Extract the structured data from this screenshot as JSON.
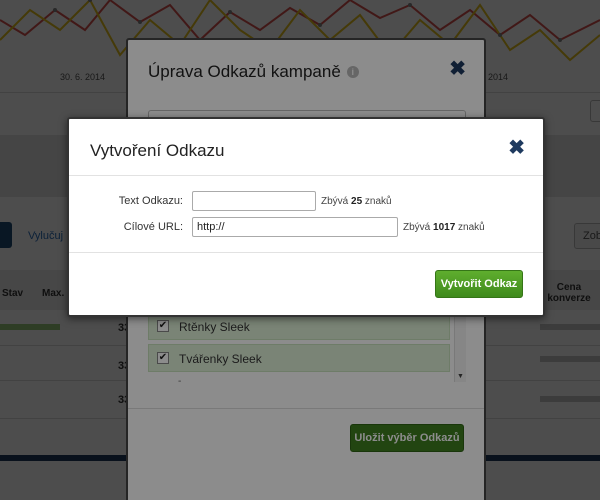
{
  "background": {
    "chart_axis_labels": [
      "30. 6. 2014",
      "2014"
    ],
    "link_text": "Vylučuj",
    "right_button_label": "Zob",
    "table_headers": [
      "Stav",
      "Max.",
      "Cena konverze"
    ],
    "row_values": [
      "33",
      "33",
      "33"
    ]
  },
  "modal_edit": {
    "title": "Úprava Odkazů kampaně",
    "info_icon": "i",
    "close_icon": "✖",
    "list_items": [
      {
        "label": "Rtěnky Sleek",
        "checked": true
      },
      {
        "label": "Tvářenky Sleek",
        "checked": true
      }
    ],
    "list_more": "-",
    "save_label": "Uložit výběr Odkazů"
  },
  "modal_create": {
    "title": "Vytvoření Odkazu",
    "close_icon": "✖",
    "text_label": "Text Odkazu:",
    "text_value": "",
    "text_hint_prefix": "Zbývá",
    "text_hint_count": "25",
    "text_hint_suffix": "znaků",
    "url_label": "Cílové URL:",
    "url_value": "http://",
    "url_hint_prefix": "Zbývá",
    "url_hint_count": "1017",
    "url_hint_suffix": "znaků",
    "create_label": "Vytvořit Odkaz"
  },
  "colors": {
    "primary_green": "#3f8a1c",
    "close_navy": "#1e3a5f",
    "chart_red": "#d9534f",
    "chart_yellow": "#e8c21c"
  }
}
